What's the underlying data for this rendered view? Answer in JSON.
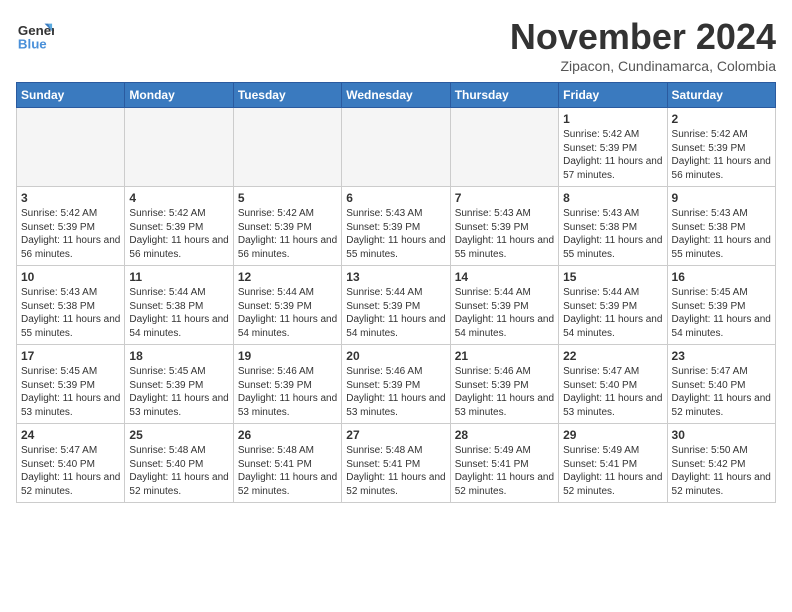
{
  "header": {
    "logo_line1": "General",
    "logo_line2": "Blue",
    "month": "November 2024",
    "location": "Zipacon, Cundinamarca, Colombia"
  },
  "days_of_week": [
    "Sunday",
    "Monday",
    "Tuesday",
    "Wednesday",
    "Thursday",
    "Friday",
    "Saturday"
  ],
  "weeks": [
    [
      {
        "day": "",
        "empty": true
      },
      {
        "day": "",
        "empty": true
      },
      {
        "day": "",
        "empty": true
      },
      {
        "day": "",
        "empty": true
      },
      {
        "day": "",
        "empty": true
      },
      {
        "day": "1",
        "sunrise": "Sunrise: 5:42 AM",
        "sunset": "Sunset: 5:39 PM",
        "daylight": "Daylight: 11 hours and 57 minutes."
      },
      {
        "day": "2",
        "sunrise": "Sunrise: 5:42 AM",
        "sunset": "Sunset: 5:39 PM",
        "daylight": "Daylight: 11 hours and 56 minutes."
      }
    ],
    [
      {
        "day": "3",
        "sunrise": "Sunrise: 5:42 AM",
        "sunset": "Sunset: 5:39 PM",
        "daylight": "Daylight: 11 hours and 56 minutes."
      },
      {
        "day": "4",
        "sunrise": "Sunrise: 5:42 AM",
        "sunset": "Sunset: 5:39 PM",
        "daylight": "Daylight: 11 hours and 56 minutes."
      },
      {
        "day": "5",
        "sunrise": "Sunrise: 5:42 AM",
        "sunset": "Sunset: 5:39 PM",
        "daylight": "Daylight: 11 hours and 56 minutes."
      },
      {
        "day": "6",
        "sunrise": "Sunrise: 5:43 AM",
        "sunset": "Sunset: 5:39 PM",
        "daylight": "Daylight: 11 hours and 55 minutes."
      },
      {
        "day": "7",
        "sunrise": "Sunrise: 5:43 AM",
        "sunset": "Sunset: 5:39 PM",
        "daylight": "Daylight: 11 hours and 55 minutes."
      },
      {
        "day": "8",
        "sunrise": "Sunrise: 5:43 AM",
        "sunset": "Sunset: 5:38 PM",
        "daylight": "Daylight: 11 hours and 55 minutes."
      },
      {
        "day": "9",
        "sunrise": "Sunrise: 5:43 AM",
        "sunset": "Sunset: 5:38 PM",
        "daylight": "Daylight: 11 hours and 55 minutes."
      }
    ],
    [
      {
        "day": "10",
        "sunrise": "Sunrise: 5:43 AM",
        "sunset": "Sunset: 5:38 PM",
        "daylight": "Daylight: 11 hours and 55 minutes."
      },
      {
        "day": "11",
        "sunrise": "Sunrise: 5:44 AM",
        "sunset": "Sunset: 5:38 PM",
        "daylight": "Daylight: 11 hours and 54 minutes."
      },
      {
        "day": "12",
        "sunrise": "Sunrise: 5:44 AM",
        "sunset": "Sunset: 5:39 PM",
        "daylight": "Daylight: 11 hours and 54 minutes."
      },
      {
        "day": "13",
        "sunrise": "Sunrise: 5:44 AM",
        "sunset": "Sunset: 5:39 PM",
        "daylight": "Daylight: 11 hours and 54 minutes."
      },
      {
        "day": "14",
        "sunrise": "Sunrise: 5:44 AM",
        "sunset": "Sunset: 5:39 PM",
        "daylight": "Daylight: 11 hours and 54 minutes."
      },
      {
        "day": "15",
        "sunrise": "Sunrise: 5:44 AM",
        "sunset": "Sunset: 5:39 PM",
        "daylight": "Daylight: 11 hours and 54 minutes."
      },
      {
        "day": "16",
        "sunrise": "Sunrise: 5:45 AM",
        "sunset": "Sunset: 5:39 PM",
        "daylight": "Daylight: 11 hours and 54 minutes."
      }
    ],
    [
      {
        "day": "17",
        "sunrise": "Sunrise: 5:45 AM",
        "sunset": "Sunset: 5:39 PM",
        "daylight": "Daylight: 11 hours and 53 minutes."
      },
      {
        "day": "18",
        "sunrise": "Sunrise: 5:45 AM",
        "sunset": "Sunset: 5:39 PM",
        "daylight": "Daylight: 11 hours and 53 minutes."
      },
      {
        "day": "19",
        "sunrise": "Sunrise: 5:46 AM",
        "sunset": "Sunset: 5:39 PM",
        "daylight": "Daylight: 11 hours and 53 minutes."
      },
      {
        "day": "20",
        "sunrise": "Sunrise: 5:46 AM",
        "sunset": "Sunset: 5:39 PM",
        "daylight": "Daylight: 11 hours and 53 minutes."
      },
      {
        "day": "21",
        "sunrise": "Sunrise: 5:46 AM",
        "sunset": "Sunset: 5:39 PM",
        "daylight": "Daylight: 11 hours and 53 minutes."
      },
      {
        "day": "22",
        "sunrise": "Sunrise: 5:47 AM",
        "sunset": "Sunset: 5:40 PM",
        "daylight": "Daylight: 11 hours and 53 minutes."
      },
      {
        "day": "23",
        "sunrise": "Sunrise: 5:47 AM",
        "sunset": "Sunset: 5:40 PM",
        "daylight": "Daylight: 11 hours and 52 minutes."
      }
    ],
    [
      {
        "day": "24",
        "sunrise": "Sunrise: 5:47 AM",
        "sunset": "Sunset: 5:40 PM",
        "daylight": "Daylight: 11 hours and 52 minutes."
      },
      {
        "day": "25",
        "sunrise": "Sunrise: 5:48 AM",
        "sunset": "Sunset: 5:40 PM",
        "daylight": "Daylight: 11 hours and 52 minutes."
      },
      {
        "day": "26",
        "sunrise": "Sunrise: 5:48 AM",
        "sunset": "Sunset: 5:41 PM",
        "daylight": "Daylight: 11 hours and 52 minutes."
      },
      {
        "day": "27",
        "sunrise": "Sunrise: 5:48 AM",
        "sunset": "Sunset: 5:41 PM",
        "daylight": "Daylight: 11 hours and 52 minutes."
      },
      {
        "day": "28",
        "sunrise": "Sunrise: 5:49 AM",
        "sunset": "Sunset: 5:41 PM",
        "daylight": "Daylight: 11 hours and 52 minutes."
      },
      {
        "day": "29",
        "sunrise": "Sunrise: 5:49 AM",
        "sunset": "Sunset: 5:41 PM",
        "daylight": "Daylight: 11 hours and 52 minutes."
      },
      {
        "day": "30",
        "sunrise": "Sunrise: 5:50 AM",
        "sunset": "Sunset: 5:42 PM",
        "daylight": "Daylight: 11 hours and 52 minutes."
      }
    ]
  ]
}
